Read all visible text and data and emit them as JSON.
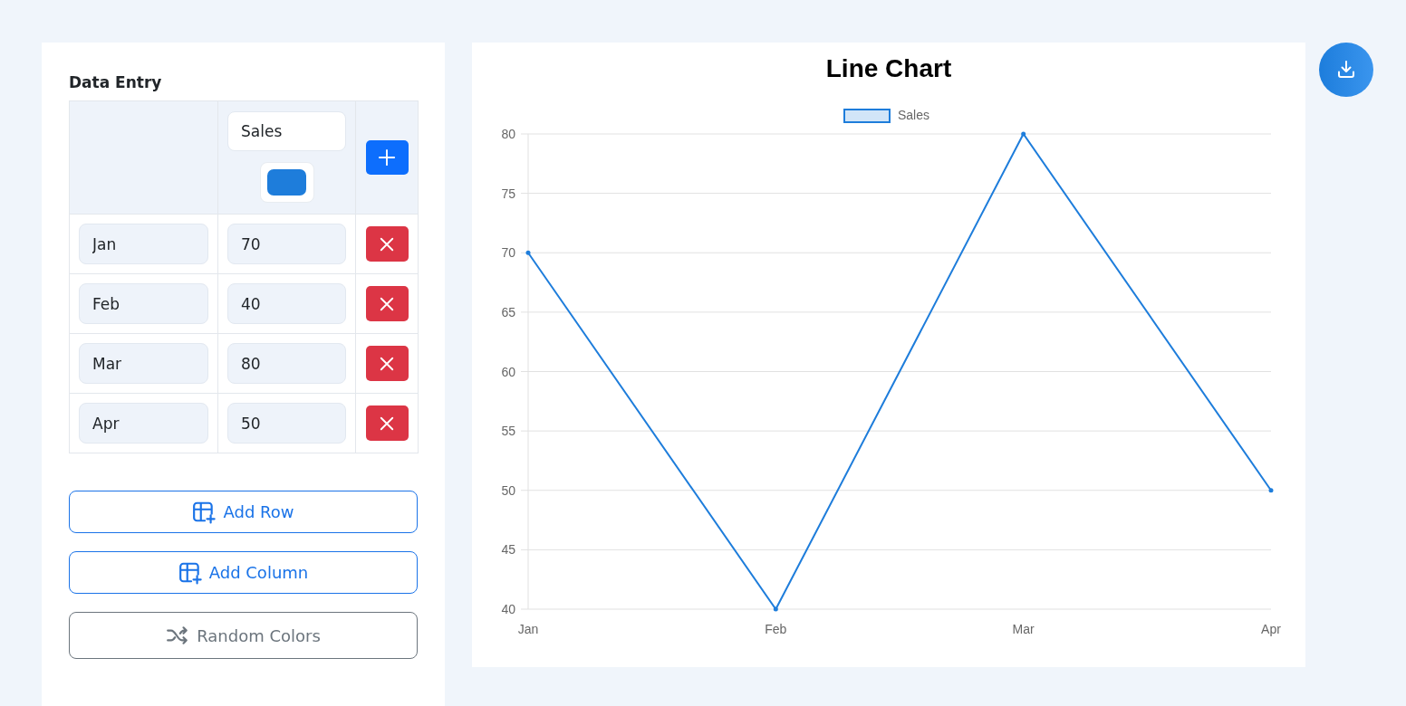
{
  "data_entry": {
    "title": "Data Entry",
    "columns": [
      {
        "value": "Sales",
        "color": "#1e7ddb"
      }
    ],
    "rows": [
      {
        "label": "Jan",
        "values": [
          "70"
        ]
      },
      {
        "label": "Feb",
        "values": [
          "40"
        ]
      },
      {
        "label": "Mar",
        "values": [
          "80"
        ]
      },
      {
        "label": "Apr",
        "values": [
          "50"
        ]
      }
    ]
  },
  "buttons": [
    {
      "label": "Add Row",
      "kind": "add"
    },
    {
      "label": "Add Column",
      "kind": "add"
    },
    {
      "label": "Random Colors",
      "kind": "shuffle"
    }
  ],
  "chart": {
    "chart_data": {
      "type": "line",
      "title": "Line Chart",
      "categories": [
        "Jan",
        "Feb",
        "Mar",
        "Apr"
      ],
      "series": [
        {
          "name": "Sales",
          "color": "#1e7ddb",
          "values": [
            70,
            40,
            80,
            50
          ]
        }
      ],
      "ylim": [
        40,
        80
      ],
      "yticks": [
        40,
        45,
        50,
        55,
        60,
        65,
        70,
        75,
        80
      ],
      "grid": true
    }
  }
}
